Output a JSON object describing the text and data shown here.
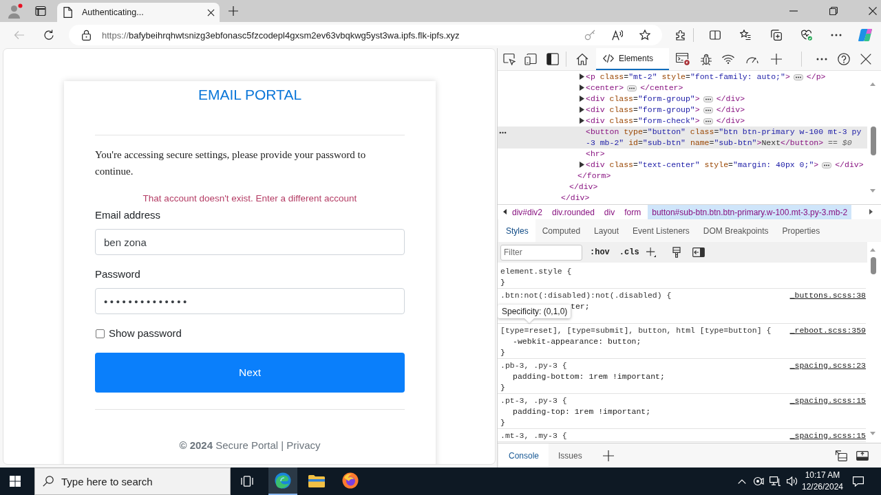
{
  "browser": {
    "tabs": [
      {
        "title": "Authenticating...",
        "selected": true
      }
    ],
    "back_button": {
      "disabled": true
    },
    "address": {
      "scheme": "https://",
      "host": "bafybeihrqhwtsnizg3ebfonasc5fzcodepl4gxsm2ev63vbqkwg5yst3wa.ipfs.flk-ipfs.xyz"
    }
  },
  "page": {
    "title": "EMAIL PORTAL",
    "message": "You're accessing secure settings, please provide your password to continue.",
    "error": "That account doesn't exist. Enter a different account",
    "fields": [
      {
        "kind": "text",
        "label": "Email address",
        "value": "ben zona"
      },
      {
        "kind": "password",
        "label": "Password",
        "value": "••••••••••••••"
      }
    ],
    "show_password": {
      "label": "Show password",
      "checked": false
    },
    "submit": "Next",
    "footer": "**© 2024** Secure Portal | Privacy"
  },
  "devtools": {
    "tools": [
      {
        "label": "Elements",
        "selected": true
      }
    ],
    "dom_tree": [
      {
        "kind": "container",
        "closing": "</div>",
        "selected": false,
        "children": [
          {
            "kind": "container",
            "closing": "</div>",
            "selected": false,
            "children": [
              {
                "kind": "container",
                "closing": "</form>",
                "selected": false,
                "children": [
                  {
                    "kind": "collapsed",
                    "open": "<p class=\"mt-2\" style=\"font-family: auto;\">",
                    "close": "</p>",
                    "selected": false
                  },
                  {
                    "kind": "collapsed",
                    "open": "<center>",
                    "close": "</center>",
                    "selected": false
                  },
                  {
                    "kind": "collapsed",
                    "open": "<div class=\"form-group\">",
                    "close": "</div>",
                    "selected": false
                  },
                  {
                    "kind": "collapsed",
                    "open": "<div class=\"form-group\">",
                    "close": "</div>",
                    "selected": false
                  },
                  {
                    "kind": "collapsed",
                    "open": "<div class=\"form-check\">",
                    "close": "</div>",
                    "selected": false
                  },
                  {
                    "kind": "leaf",
                    "text": "<button type=\"button\" class=\"btn btn-primary w-100 mt-3 py-3 mb-2\" id=\"sub-btn\" name=\"sub-btn\">Next</button>",
                    "suffix": "== *$0*",
                    "selected": true
                  },
                  {
                    "kind": "leaf",
                    "text": "<hr>",
                    "selected": false
                  },
                  {
                    "kind": "collapsed",
                    "open": "<div class=\"text-center\" style=\"margin: 40px 0;\">",
                    "close": "</div>",
                    "selected": false
                  }
                ]
              }
            ]
          }
        ]
      }
    ],
    "breadcrumbs": [
      {
        "label": "div#div2",
        "selected": false
      },
      {
        "label": "div.rounded",
        "selected": false
      },
      {
        "label": "div",
        "selected": false
      },
      {
        "label": "form",
        "selected": false
      },
      {
        "label": "button#sub-btn.btn.btn-primary.w-100.mt-3.py-3.mb-2",
        "selected": true
      }
    ],
    "panel_tabs": [
      {
        "label": "Styles",
        "selected": true
      },
      {
        "label": "Computed",
        "selected": false
      },
      {
        "label": "Layout",
        "selected": false
      },
      {
        "label": "Event Listeners",
        "selected": false
      },
      {
        "label": "DOM Breakpoints",
        "selected": false
      },
      {
        "label": "Properties",
        "selected": false
      }
    ],
    "filter": {
      "placeholder": "Filter"
    },
    "filter_buttons": [
      ":hov",
      ".cls"
    ],
    "rules": [
      {
        "selector": "element.style {",
        "close": "}"
      },
      {
        "selector": ".btn:not(:disabled):not(.disabled) {",
        "source": "_buttons.scss:38",
        "declarations": [
          "ter;"
        ],
        "tooltip": "Specificity: (0,1,0)"
      },
      {
        "selector": "[type=reset], [type=submit], button, html [type=button] {",
        "source": "_reboot.scss:359",
        "declarations": [
          "-webkit-appearance: button;"
        ],
        "close": "}"
      },
      {
        "selector": ".pb-3, .py-3 {",
        "source": "_spacing.scss:23",
        "declarations": [
          "padding-bottom: 1rem !important;"
        ],
        "close": "}"
      },
      {
        "selector": ".pt-3, .py-3 {",
        "source": "_spacing.scss:15",
        "declarations": [
          "padding-top: 1rem !important;"
        ],
        "close": "}"
      },
      {
        "selector": ".mt-3, .my-3 {",
        "source": "_spacing.scss:15"
      }
    ],
    "drawer_tabs": [
      {
        "label": "Console",
        "selected": true
      },
      {
        "label": "Issues",
        "selected": false
      }
    ]
  },
  "taskbar": {
    "search": {
      "placeholder": "Type here to search"
    },
    "apps": [
      {
        "kind": "browser",
        "active": true
      },
      {
        "kind": "files",
        "active": false
      },
      {
        "kind": "fox",
        "active": false
      }
    ],
    "time": "10:17 AM",
    "date": "12/26/2024"
  }
}
